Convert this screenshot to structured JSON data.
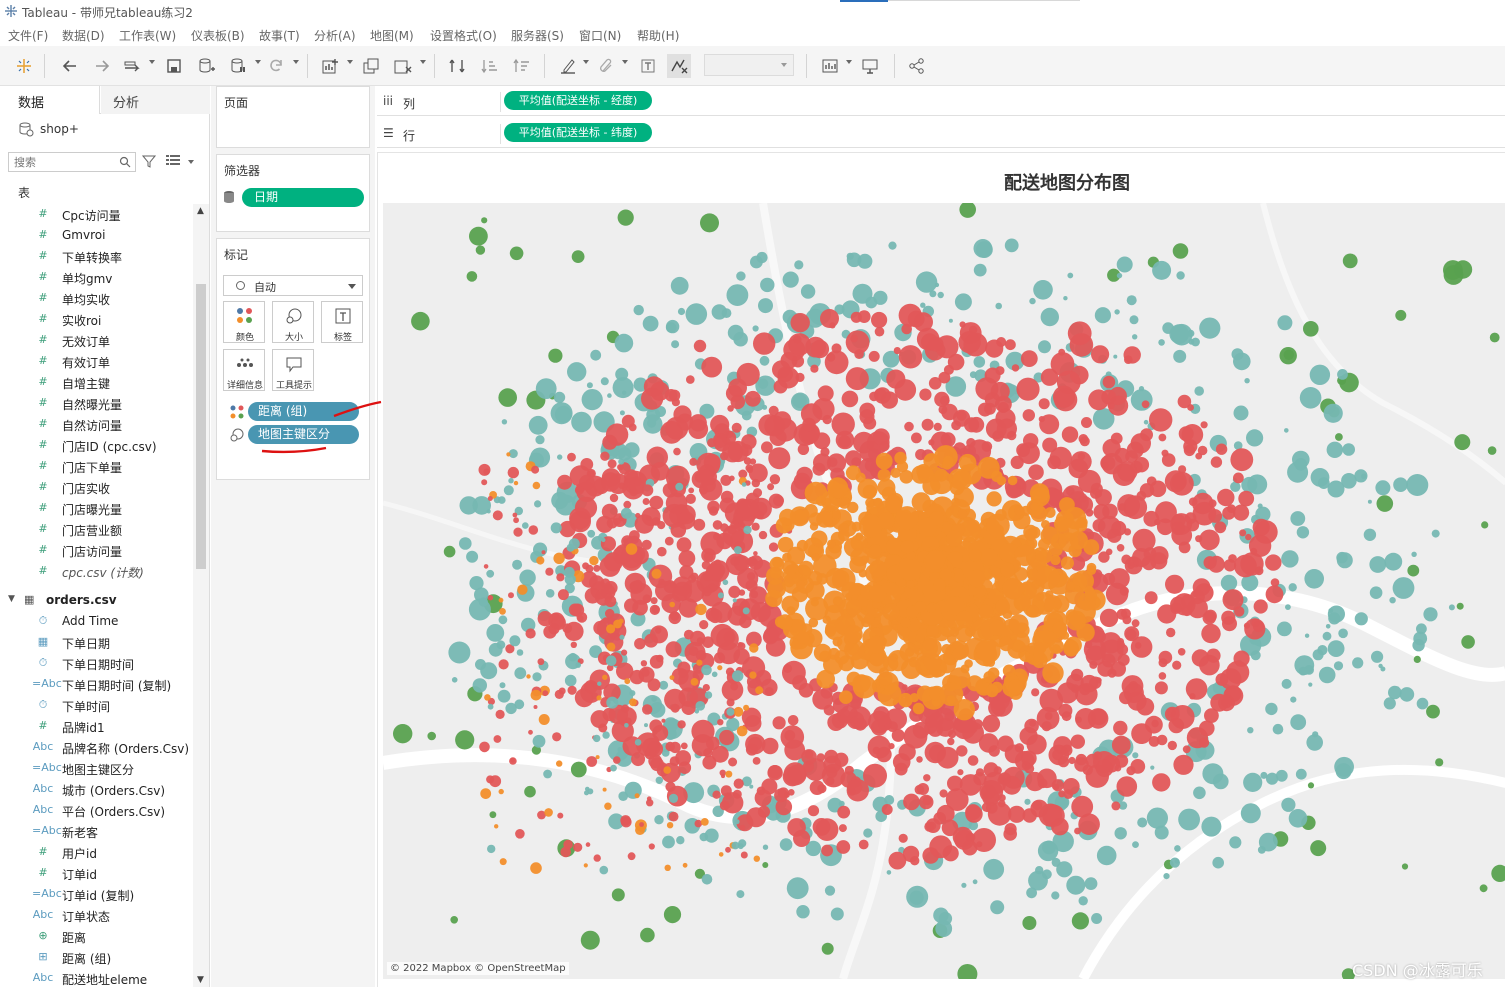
{
  "app": {
    "title": "Tableau - 带师兄tableau练习2"
  },
  "menu": [
    "文件(F)",
    "数据(D)",
    "工作表(W)",
    "仪表板(B)",
    "故事(T)",
    "分析(A)",
    "地图(M)",
    "设置格式(O)",
    "服务器(S)",
    "窗口(N)",
    "帮助(H)"
  ],
  "data_pane": {
    "tab_data": "数据",
    "tab_analysis": "分析",
    "datasource": "shop+",
    "search_placeholder": "搜索",
    "tables_label": "表",
    "fields": [
      {
        "icon": "#",
        "label": "Cpc访问量"
      },
      {
        "icon": "#",
        "label": "Gmvroi"
      },
      {
        "icon": "#",
        "label": "下单转换率"
      },
      {
        "icon": "#",
        "label": "单均gmv"
      },
      {
        "icon": "#",
        "label": "单均实收"
      },
      {
        "icon": "#",
        "label": "实收roi"
      },
      {
        "icon": "#",
        "label": "无效订单"
      },
      {
        "icon": "#",
        "label": "有效订单"
      },
      {
        "icon": "#",
        "label": "自增主键"
      },
      {
        "icon": "#",
        "label": "自然曝光量"
      },
      {
        "icon": "#",
        "label": "自然访问量"
      },
      {
        "icon": "#",
        "label": "门店ID (cpc.csv)"
      },
      {
        "icon": "#",
        "label": "门店下单量"
      },
      {
        "icon": "#",
        "label": "门店实收"
      },
      {
        "icon": "#",
        "label": "门店曝光量"
      },
      {
        "icon": "#",
        "label": "门店营业额"
      },
      {
        "icon": "#",
        "label": "门店访问量"
      },
      {
        "icon": "#",
        "label": "cpc.csv (计数)",
        "italic": true
      }
    ],
    "table2": "orders.csv",
    "fields2": [
      {
        "icon": "⏱",
        "label": "Add Time"
      },
      {
        "icon": "▦",
        "label": "下单日期"
      },
      {
        "icon": "⏱",
        "label": "下单日期时间"
      },
      {
        "icon": "=Abc",
        "label": "下单日期时间 (复制)"
      },
      {
        "icon": "⏱",
        "label": "下单时间"
      },
      {
        "icon": "#",
        "label": "品牌id1"
      },
      {
        "icon": "Abc",
        "label": "品牌名称 (Orders.Csv)"
      },
      {
        "icon": "=Abc",
        "label": "地图主键区分"
      },
      {
        "icon": "Abc",
        "label": "城市 (Orders.Csv)"
      },
      {
        "icon": "Abc",
        "label": "平台 (Orders.Csv)"
      },
      {
        "icon": "=Abc",
        "label": "新老客"
      },
      {
        "icon": "#",
        "label": "用户id"
      },
      {
        "icon": "#",
        "label": "订单id"
      },
      {
        "icon": "=Abc",
        "label": "订单id (复制)"
      },
      {
        "icon": "Abc",
        "label": "订单状态"
      },
      {
        "icon": "⊕",
        "label": "距离"
      },
      {
        "icon": "⊞",
        "label": "距离 (组)"
      },
      {
        "icon": "Abc",
        "label": "配送地址eleme"
      }
    ]
  },
  "pages": {
    "title": "页面"
  },
  "filters": {
    "title": "筛选器",
    "pill": "日期"
  },
  "marks": {
    "title": "标记",
    "type": "自动",
    "buttons": [
      "颜色",
      "大小",
      "标签",
      "详细信息",
      "工具提示"
    ],
    "pills": [
      "距离 (组)",
      "地图主键区分"
    ]
  },
  "shelves": {
    "columns_label": "列",
    "rows_label": "行",
    "columns_pill": "平均值(配送坐标 - 经度)",
    "rows_pill": "平均值(配送坐标 - 纬度)"
  },
  "viz": {
    "title": "配送地图分布图",
    "attribution": "© 2022 Mapbox © OpenStreetMap",
    "colors": {
      "red": "#e15759",
      "orange": "#f28e2b",
      "teal": "#76b7b2",
      "green": "#59a14f"
    }
  },
  "watermark": "CSDN @冰露可乐"
}
